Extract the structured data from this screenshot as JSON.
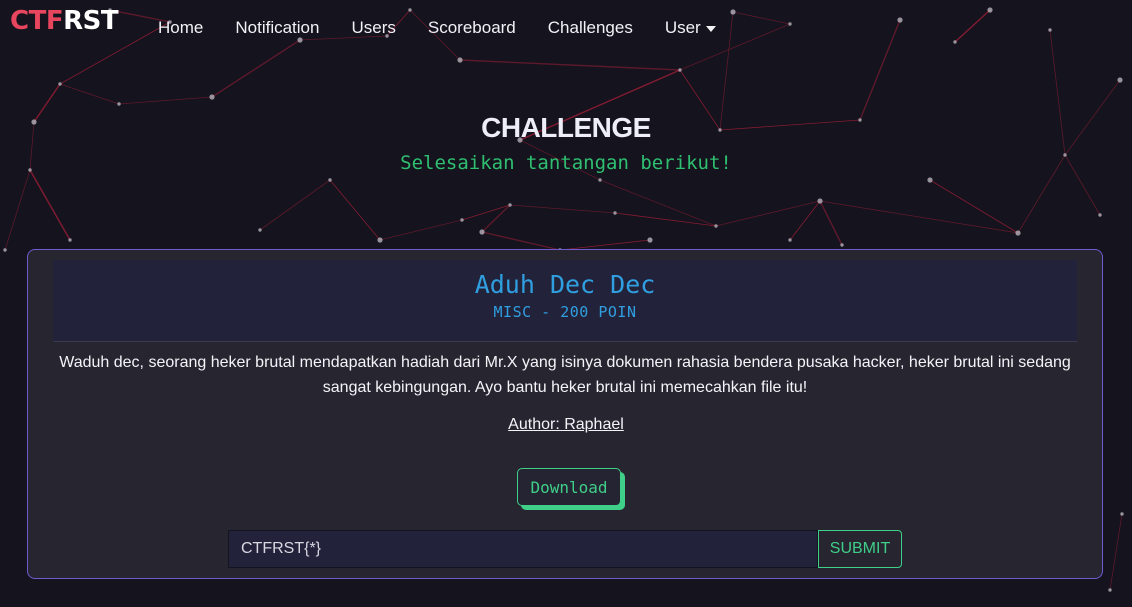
{
  "brand": {
    "part1": "CTF",
    "part2": "RST"
  },
  "nav": {
    "items": [
      {
        "label": "Home"
      },
      {
        "label": "Notification"
      },
      {
        "label": "Users"
      },
      {
        "label": "Scoreboard"
      },
      {
        "label": "Challenges"
      },
      {
        "label": "User"
      }
    ]
  },
  "hero": {
    "title": "CHALLENGE",
    "subtitle": "Selesaikan tantangan berikut!"
  },
  "challenge": {
    "name": "Aduh Dec Dec",
    "meta": "MISC - 200 POIN",
    "description": "Waduh dec, seorang heker brutal mendapatkan hadiah dari Mr.X yang isinya dokumen rahasia bendera pusaka hacker, heker brutal ini sedang sangat kebingungan. Ayo bantu heker brutal ini memecahkan file itu!",
    "author": "Author: Raphael",
    "download_label": "Download"
  },
  "flag_form": {
    "placeholder": "CTFRST{*}",
    "submit_label": "SUBMIT"
  },
  "colors": {
    "background": "#15131d",
    "brand_red": "#e8455e",
    "accent_green": "#3fcf88",
    "accent_blue": "#2f9fe0",
    "card_border": "#6d5bd0"
  },
  "icons": {
    "user_dropdown": "caret-down-icon"
  }
}
